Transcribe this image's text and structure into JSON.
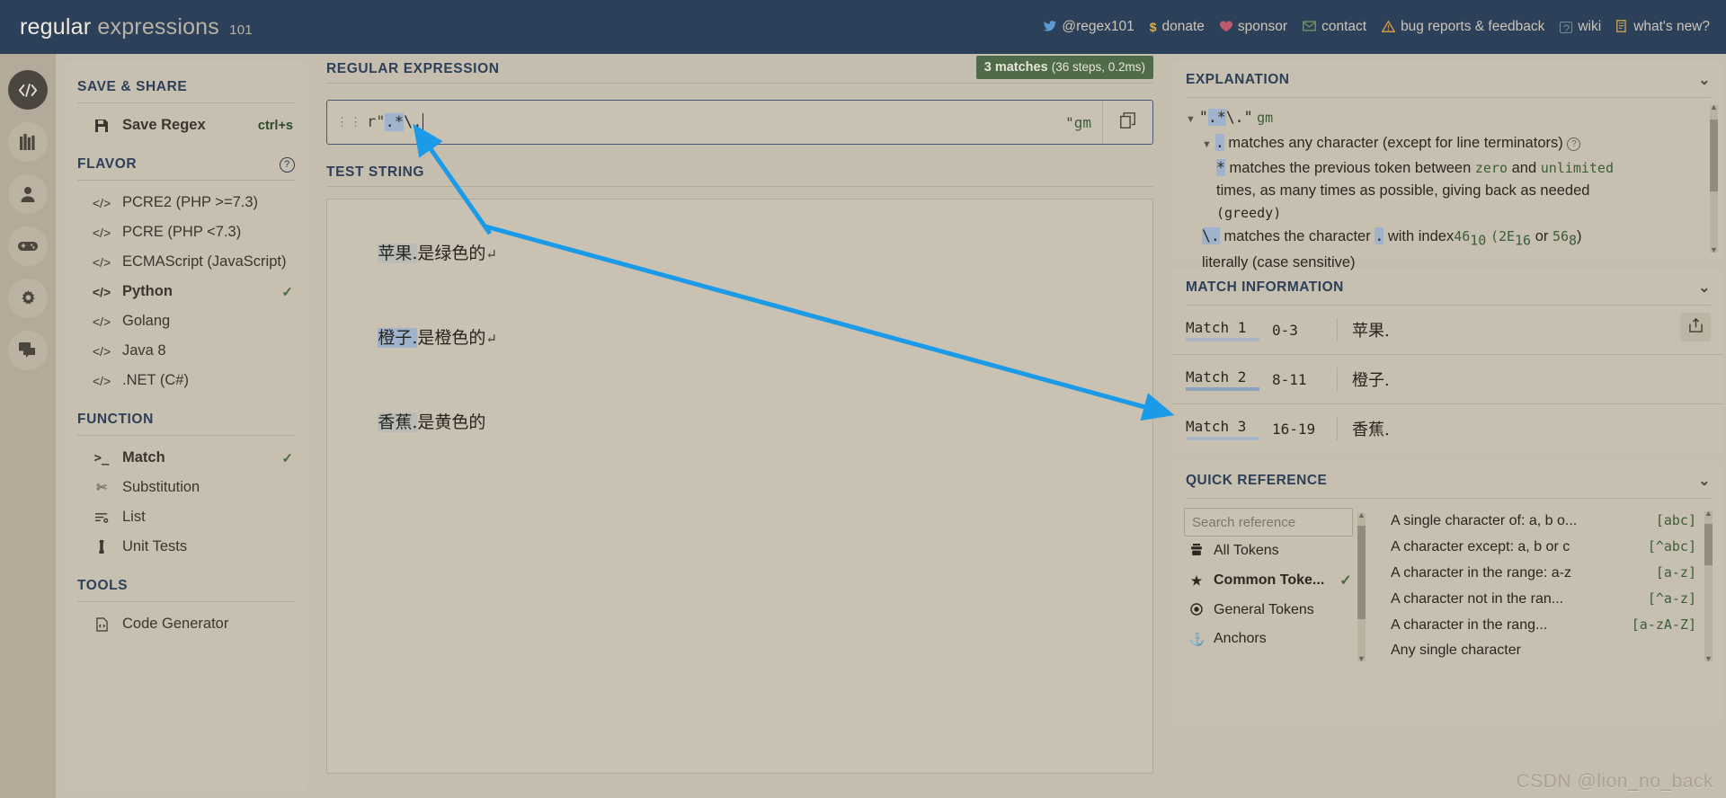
{
  "topbar": {
    "brand_1": "regular",
    "brand_2": "expressions",
    "brand_3": "101",
    "nav": [
      {
        "icon": "twitter-icon",
        "label": "@regex101"
      },
      {
        "icon": "dollar-icon",
        "label": "donate"
      },
      {
        "icon": "heart-icon",
        "label": "sponsor"
      },
      {
        "icon": "mail-icon",
        "label": "contact"
      },
      {
        "icon": "warning-icon",
        "label": "bug reports & feedback"
      },
      {
        "icon": "wiki-icon",
        "label": "wiki"
      },
      {
        "icon": "news-icon",
        "label": "what's new?"
      }
    ]
  },
  "rail": {
    "items": [
      {
        "icon": "code-icon",
        "active": true
      },
      {
        "icon": "library-icon",
        "active": false
      },
      {
        "icon": "account-icon",
        "active": false
      },
      {
        "icon": "gamepad-icon",
        "active": false
      },
      {
        "icon": "settings-icon",
        "active": false
      },
      {
        "icon": "chat-icon",
        "active": false
      }
    ]
  },
  "sidebar": {
    "save_share_title": "SAVE & SHARE",
    "save_regex_label": "Save Regex",
    "save_regex_shortcut": "ctrl+s",
    "flavor_title": "FLAVOR",
    "flavors": [
      {
        "label": "PCRE2 (PHP >=7.3)",
        "selected": false
      },
      {
        "label": "PCRE (PHP <7.3)",
        "selected": false
      },
      {
        "label": "ECMAScript (JavaScript)",
        "selected": false
      },
      {
        "label": "Python",
        "selected": true
      },
      {
        "label": "Golang",
        "selected": false
      },
      {
        "label": "Java 8",
        "selected": false
      },
      {
        "label": ".NET (C#)",
        "selected": false
      }
    ],
    "function_title": "FUNCTION",
    "functions": [
      {
        "label": "Match",
        "icon": "terminal-icon",
        "selected": true
      },
      {
        "label": "Substitution",
        "icon": "scissors-icon",
        "selected": false
      },
      {
        "label": "List",
        "icon": "list-icon",
        "selected": false
      },
      {
        "label": "Unit Tests",
        "icon": "test-tube-icon",
        "selected": false
      }
    ],
    "tools_title": "TOOLS",
    "tools": [
      {
        "label": "Code Generator",
        "icon": "code-file-icon"
      }
    ]
  },
  "regex_panel": {
    "title": "REGULAR EXPRESSION",
    "match_count": "3 matches",
    "match_stats": "(36 steps, 0.2ms)",
    "prefix": "r\"",
    "pattern_highlighted": ".*",
    "pattern_tail": "\\.",
    "closing_quote": "\"",
    "flags": "gm",
    "copy_icon": "copy-icon"
  },
  "test_string_panel": {
    "title": "TEST STRING",
    "lines": [
      {
        "match": "苹果.",
        "match_style": "light",
        "rest": "是绿色的",
        "newline": "↵"
      },
      {
        "match": "橙子.",
        "match_style": "blue",
        "rest": "是橙色的",
        "newline": "↵"
      },
      {
        "match": "香蕉.",
        "match_style": "light",
        "rest": "是黄色的",
        "newline": ""
      }
    ]
  },
  "explanation_panel": {
    "title": "EXPLANATION",
    "header_quote_open": "\"",
    "header_token_a": ".*",
    "header_token_b": "\\.",
    "header_quote_close": "\"",
    "header_flags": "gm",
    "line_dot_token": ".",
    "line_dot_text": "matches any character (except for line terminators)",
    "line_star_token": "*",
    "line_star_text_1": "matches the previous token between",
    "line_star_zero": "zero",
    "line_star_and": "and",
    "line_star_unlimited": "unlimited",
    "line_star_text_2": "times, as many times as possible, giving back as needed",
    "line_star_greedy": "(greedy)",
    "line_esc_token": "\\.",
    "line_esc_text_1": "matches the character",
    "line_esc_char": ".",
    "line_esc_text_2": "with index",
    "line_esc_dec": "46",
    "line_esc_dec_sub": "10",
    "line_esc_hex_open": "(2E",
    "line_esc_hex_sub": "16",
    "line_esc_or": "or",
    "line_esc_oct": "56",
    "line_esc_oct_sub": "8",
    "line_esc_close": ")",
    "line_literal": "literally (case sensitive)"
  },
  "match_info_panel": {
    "title": "MATCH INFORMATION",
    "share_icon": "share-icon",
    "matches": [
      {
        "label": "Match 1",
        "range": "0-3",
        "text": "苹果.",
        "style": "light"
      },
      {
        "label": "Match 2",
        "range": "8-11",
        "text": "橙子.",
        "style": "blue"
      },
      {
        "label": "Match 3",
        "range": "16-19",
        "text": "香蕉.",
        "style": "light"
      }
    ]
  },
  "quick_reference_panel": {
    "title": "QUICK REFERENCE",
    "search_placeholder": "Search reference",
    "search_value": "",
    "categories": [
      {
        "label": "All Tokens",
        "icon": "tokens-icon",
        "selected": false
      },
      {
        "label": "Common Toke...",
        "icon": "star-icon",
        "selected": true
      },
      {
        "label": "General Tokens",
        "icon": "target-icon",
        "selected": false
      },
      {
        "label": "Anchors",
        "icon": "anchor-icon",
        "selected": false
      }
    ],
    "rows": [
      {
        "desc": "A single character of: a, b o...",
        "code": "[abc]"
      },
      {
        "desc": "A character except: a, b or c",
        "code": "[^abc]"
      },
      {
        "desc": "A character in the range: a-z",
        "code": "[a-z]"
      },
      {
        "desc": "A character not in the ran...",
        "code": "[^a-z]"
      },
      {
        "desc": "A character in the rang...",
        "code": "[a-zA-Z]"
      },
      {
        "desc": "Any single character",
        "code": ""
      }
    ]
  },
  "watermark": "CSDN @lion_no_back"
}
